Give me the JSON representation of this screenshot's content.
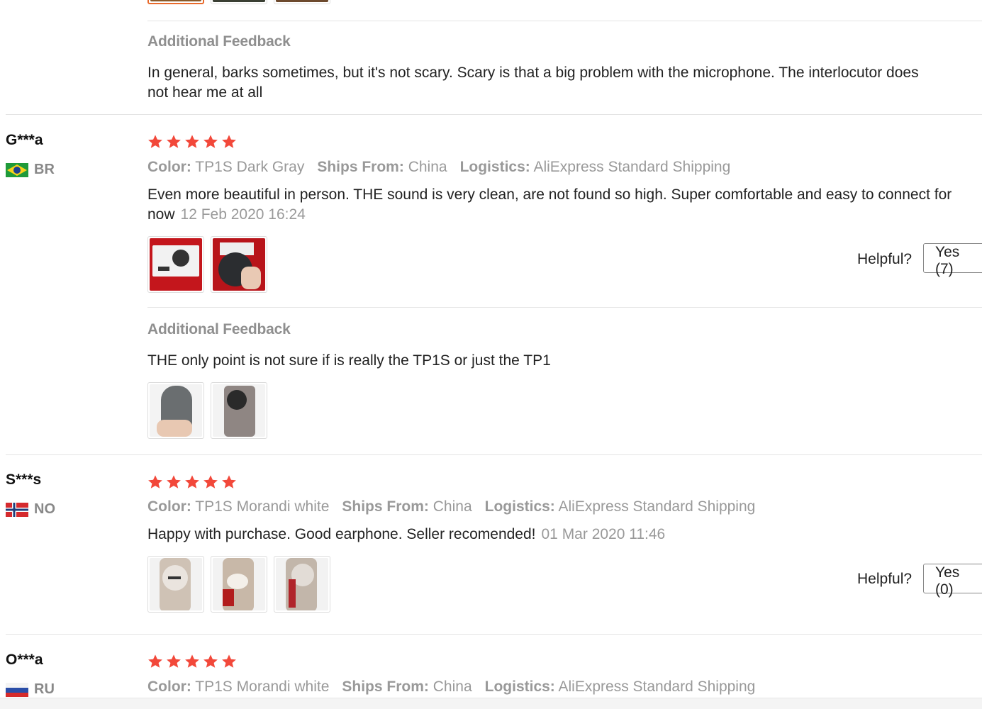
{
  "reviews": [
    {
      "additional_feedback_title": "Additional Feedback",
      "additional_feedback_text": "In general, barks sometimes, but it's not scary. Scary is that a big problem with the microphone. The interlocutor does not hear me at all"
    },
    {
      "user": "G***a",
      "country": "BR",
      "stars": 5,
      "color_label": "Color:",
      "color_value": "TP1S Dark Gray",
      "ships_label": "Ships From:",
      "ships_value": "China",
      "logistics_label": "Logistics:",
      "logistics_value": "AliExpress Standard Shipping",
      "text": "Even more beautiful in person. THE sound is very clean, are not found so high. Super comfortable and easy to connect for now",
      "date": "12 Feb 2020 16:24",
      "helpful_label": "Helpful?",
      "yes_label": "Yes (7)",
      "additional_feedback_title": "Additional Feedback",
      "additional_feedback_text": "THE only point is not sure if is really the TP1S or just the TP1"
    },
    {
      "user": "S***s",
      "country": "NO",
      "stars": 5,
      "color_label": "Color:",
      "color_value": "TP1S Morandi white",
      "ships_label": "Ships From:",
      "ships_value": "China",
      "logistics_label": "Logistics:",
      "logistics_value": "AliExpress Standard Shipping",
      "text": "Happy with purchase. Good earphone. Seller recomended!",
      "date": "01 Mar 2020 11:46",
      "helpful_label": "Helpful?",
      "yes_label": "Yes (0)"
    },
    {
      "user": "O***a",
      "country": "RU",
      "stars": 5,
      "color_label": "Color:",
      "color_value": "TP1S Morandi white",
      "ships_label": "Ships From:",
      "ships_value": "China",
      "logistics_label": "Logistics:",
      "logistics_value": "AliExpress Standard Shipping"
    }
  ],
  "colors": {
    "star": "#f2483a",
    "accent_border": "#e96a2b",
    "muted_text": "#999999"
  }
}
